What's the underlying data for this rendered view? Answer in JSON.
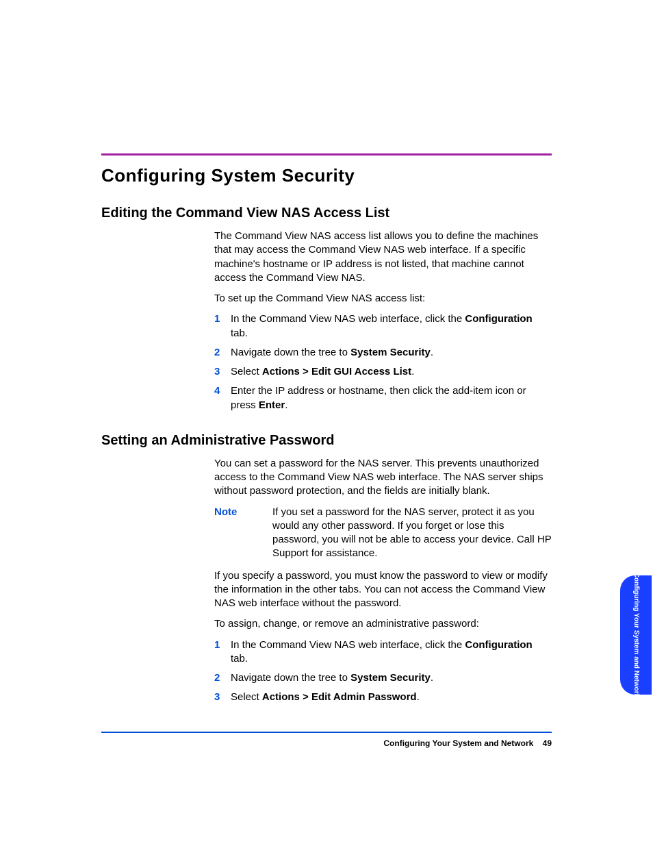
{
  "title": "Configuring System Security",
  "sections": {
    "acl": {
      "heading": "Editing the Command View NAS Access List",
      "intro": "The Command View NAS access list allows you to define the machines that may access the Command View NAS web interface. If a specific machine's hostname or IP address is not listed, that machine cannot access the Command View NAS.",
      "lead": "To set up the Command View NAS access list:",
      "steps": {
        "n1": "1",
        "s1_a": "In the Command View NAS web interface, click the ",
        "s1_b": "Configuration",
        "s1_c": " tab.",
        "n2": "2",
        "s2_a": "Navigate down the tree to ",
        "s2_b": "System Security",
        "s2_c": ".",
        "n3": "3",
        "s3_a": "Select ",
        "s3_b": "Actions > Edit GUI Access List",
        "s3_c": ".",
        "n4": "4",
        "s4_a": "Enter the IP address or hostname, then click the add-item icon or press ",
        "s4_b": "Enter",
        "s4_c": "."
      }
    },
    "pwd": {
      "heading": "Setting an Administrative Password",
      "intro": "You can set a password for the NAS server. This prevents unauthorized access to the Command View NAS web interface. The NAS server ships without password protection, and the fields are initially blank.",
      "note_label": "Note",
      "note_text": "If you set a password for the NAS server, protect it as you would any other password. If you forget or lose this password, you will not be able to access your device. Call HP Support for assistance.",
      "para2": "If you specify a password, you must know the password to view or modify the information in the other tabs. You can not access the Command View NAS web interface without the password.",
      "lead": "To assign, change, or remove an administrative password:",
      "steps": {
        "n1": "1",
        "s1_a": "In the Command View NAS web interface, click the ",
        "s1_b": "Configuration",
        "s1_c": " tab.",
        "n2": "2",
        "s2_a": "Navigate down the tree to ",
        "s2_b": "System Security",
        "s2_c": ".",
        "n3": "3",
        "s3_a": "Select ",
        "s3_b": "Actions > Edit Admin Password",
        "s3_c": "."
      }
    }
  },
  "footer": {
    "chapter": "Configuring Your System and Network",
    "page": "49"
  },
  "side_tab": "Configuring Your System and\nNetwork"
}
